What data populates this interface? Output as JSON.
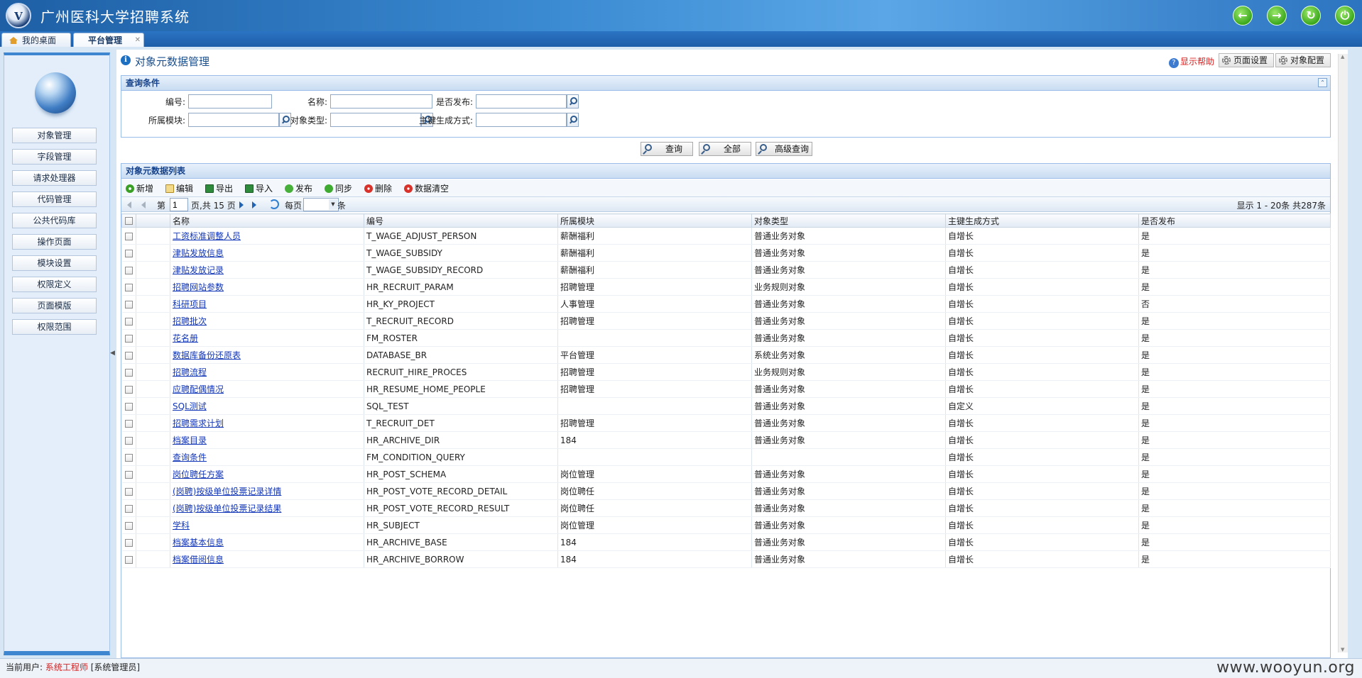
{
  "header": {
    "title": "广州医科大学招聘系统"
  },
  "tabs": [
    {
      "label": "我的桌面"
    },
    {
      "label": "平台管理"
    }
  ],
  "sidebar": {
    "items": [
      {
        "label": "对象管理"
      },
      {
        "label": "字段管理"
      },
      {
        "label": "请求处理器"
      },
      {
        "label": "代码管理"
      },
      {
        "label": "公共代码库"
      },
      {
        "label": "操作页面"
      },
      {
        "label": "模块设置"
      },
      {
        "label": "权限定义"
      },
      {
        "label": "页面模版"
      },
      {
        "label": "权限范围"
      }
    ]
  },
  "page": {
    "title": "对象元数据管理",
    "help": "显示帮助",
    "page_settings": "页面设置",
    "object_config": "对象配置"
  },
  "query": {
    "title": "查询条件",
    "fields": {
      "code": "编号:",
      "name": "名称:",
      "published": "是否发布:",
      "module": "所属模块:",
      "object_type": "对象类型:",
      "key_mode": "主键生成方式:"
    },
    "buttons": {
      "search": "查询",
      "all": "全部",
      "advanced": "高级查询"
    }
  },
  "list": {
    "title": "对象元数据列表",
    "toolbar": {
      "add": "新增",
      "edit": "编辑",
      "export": "导出",
      "import": "导入",
      "publish": "发布",
      "sync": "同步",
      "delete": "删除",
      "clear": "数据清空"
    },
    "pager": {
      "page_prefix": "第",
      "page_value": "1",
      "page_suffix": "页,共 15 页",
      "per_page": "每页",
      "unit": "条",
      "summary": "显示 1 - 20条 共287条"
    },
    "columns": {
      "name": "名称",
      "code": "编号",
      "module": "所属模块",
      "type": "对象类型",
      "key": "主键生成方式",
      "published": "是否发布"
    },
    "rows": [
      {
        "name": "工资标准调整人员",
        "code": "T_WAGE_ADJUST_PERSON",
        "module": "薪酬福利",
        "type": "普通业务对象",
        "key": "自增长",
        "published": "是"
      },
      {
        "name": "津贴发放信息",
        "code": "T_WAGE_SUBSIDY",
        "module": "薪酬福利",
        "type": "普通业务对象",
        "key": "自增长",
        "published": "是"
      },
      {
        "name": "津贴发放记录",
        "code": "T_WAGE_SUBSIDY_RECORD",
        "module": "薪酬福利",
        "type": "普通业务对象",
        "key": "自增长",
        "published": "是"
      },
      {
        "name": "招聘网站参数",
        "code": "HR_RECRUIT_PARAM",
        "module": "招聘管理",
        "type": "业务规则对象",
        "key": "自增长",
        "published": "是"
      },
      {
        "name": "科研项目",
        "code": "HR_KY_PROJECT",
        "module": "人事管理",
        "type": "普通业务对象",
        "key": "自增长",
        "published": "否"
      },
      {
        "name": "招聘批次",
        "code": "T_RECRUIT_RECORD",
        "module": "招聘管理",
        "type": "普通业务对象",
        "key": "自增长",
        "published": "是"
      },
      {
        "name": "花名册",
        "code": "FM_ROSTER",
        "module": "",
        "type": "普通业务对象",
        "key": "自增长",
        "published": "是"
      },
      {
        "name": "数据库备份还原表",
        "code": "DATABASE_BR",
        "module": "平台管理",
        "type": "系统业务对象",
        "key": "自增长",
        "published": "是"
      },
      {
        "name": "招聘流程",
        "code": "RECRUIT_HIRE_PROCES",
        "module": "招聘管理",
        "type": "业务规则对象",
        "key": "自增长",
        "published": "是"
      },
      {
        "name": "应聘配偶情况",
        "code": "HR_RESUME_HOME_PEOPLE",
        "module": "招聘管理",
        "type": "普通业务对象",
        "key": "自增长",
        "published": "是"
      },
      {
        "name": "SQL测试",
        "code": "SQL_TEST",
        "module": "",
        "type": "普通业务对象",
        "key": "自定义",
        "published": "是"
      },
      {
        "name": "招聘需求计划",
        "code": "T_RECRUIT_DET",
        "module": "招聘管理",
        "type": "普通业务对象",
        "key": "自增长",
        "published": "是"
      },
      {
        "name": "档案目录",
        "code": "HR_ARCHIVE_DIR",
        "module": "184",
        "type": "普通业务对象",
        "key": "自增长",
        "published": "是"
      },
      {
        "name": "查询条件",
        "code": "FM_CONDITION_QUERY",
        "module": "",
        "type": "",
        "key": "自增长",
        "published": "是"
      },
      {
        "name": "岗位聘任方案",
        "code": "HR_POST_SCHEMA",
        "module": "岗位管理",
        "type": "普通业务对象",
        "key": "自增长",
        "published": "是"
      },
      {
        "name": "(岗聘)按级单位投票记录详情",
        "code": "HR_POST_VOTE_RECORD_DETAIL",
        "module": "岗位聘任",
        "type": "普通业务对象",
        "key": "自增长",
        "published": "是"
      },
      {
        "name": "(岗聘)按级单位投票记录结果",
        "code": "HR_POST_VOTE_RECORD_RESULT",
        "module": "岗位聘任",
        "type": "普通业务对象",
        "key": "自增长",
        "published": "是"
      },
      {
        "name": "学科",
        "code": "HR_SUBJECT",
        "module": "岗位管理",
        "type": "普通业务对象",
        "key": "自增长",
        "published": "是"
      },
      {
        "name": "档案基本信息",
        "code": "HR_ARCHIVE_BASE",
        "module": "184",
        "type": "普通业务对象",
        "key": "自增长",
        "published": "是"
      },
      {
        "name": "档案借阅信息",
        "code": "HR_ARCHIVE_BORROW",
        "module": "184",
        "type": "普通业务对象",
        "key": "自增长",
        "published": "是"
      }
    ]
  },
  "status": {
    "prefix": "当前用户:",
    "user": "系统工程师",
    "role": "[系统管理员]"
  },
  "watermark": "www.wooyun.org",
  "colors": {
    "header": "#2d74c0",
    "accent": "#15428b",
    "link": "#1236b8",
    "status_user": "#d62020"
  },
  "icons": {
    "back": "arrow-left-icon",
    "forward": "arrow-right-icon",
    "refresh": "refresh-icon",
    "power": "power-icon"
  }
}
